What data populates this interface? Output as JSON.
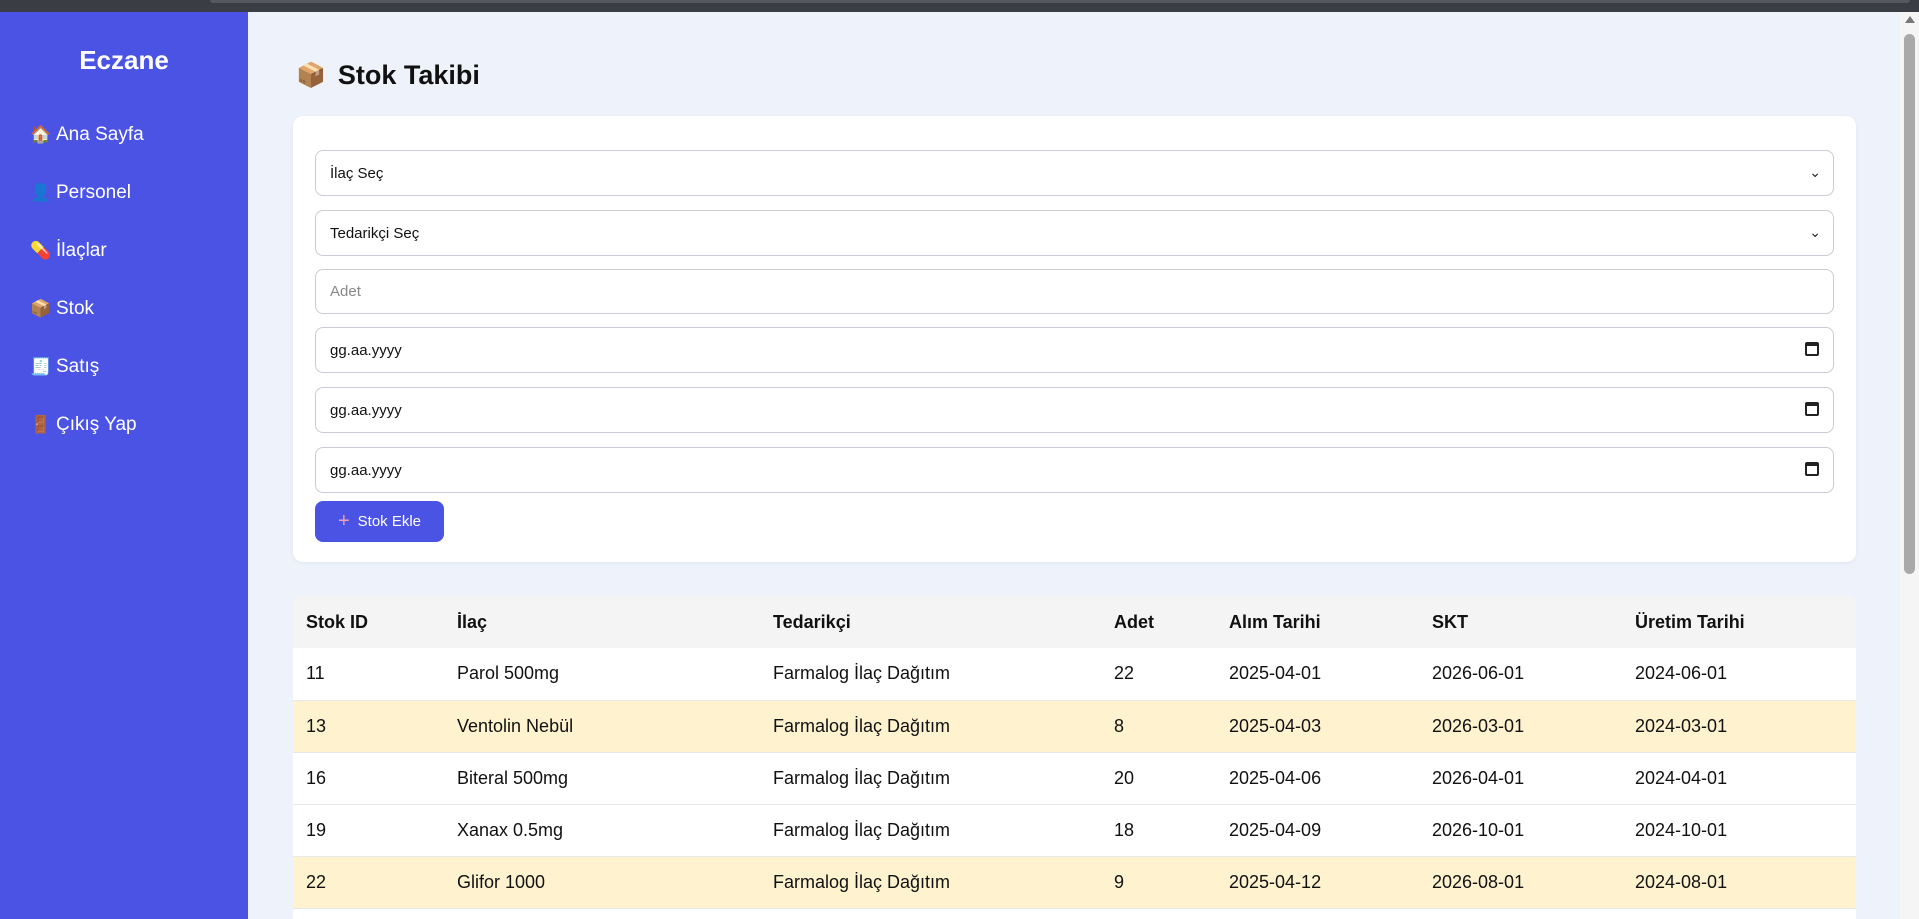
{
  "app": {
    "brand": "Eczane"
  },
  "sidebar": {
    "items": [
      {
        "icon": "🏠",
        "label": "Ana Sayfa"
      },
      {
        "icon": "👤",
        "label": "Personel"
      },
      {
        "icon": "💊",
        "label": "İlaçlar"
      },
      {
        "icon": "📦",
        "label": "Stok"
      },
      {
        "icon": "🧾",
        "label": "Satış"
      },
      {
        "icon": "🚪",
        "label": "Çıkış Yap"
      }
    ]
  },
  "page": {
    "icon": "📦",
    "title": "Stok Takibi"
  },
  "form": {
    "drug_select": "İlaç Seç",
    "supplier_select": "Tedarikçi Seç",
    "quantity_placeholder": "Adet",
    "date1": "gg.aa.yyyy",
    "date2": "gg.aa.yyyy",
    "date3": "gg.aa.yyyy",
    "add_button": "Stok Ekle",
    "add_button_icon": "+"
  },
  "table": {
    "headers": [
      "Stok ID",
      "İlaç",
      "Tedarikçi",
      "Adet",
      "Alım Tarihi",
      "SKT",
      "Üretim Tarihi"
    ],
    "rows": [
      [
        "11",
        "Parol 500mg",
        "Farmalog İlaç Dağıtım",
        "22",
        "2025-04-01",
        "2026-06-01",
        "2024-06-01"
      ],
      [
        "13",
        "Ventolin Nebül",
        "Farmalog İlaç Dağıtım",
        "8",
        "2025-04-03",
        "2026-03-01",
        "2024-03-01"
      ],
      [
        "16",
        "Biteral 500mg",
        "Farmalog İlaç Dağıtım",
        "20",
        "2025-04-06",
        "2026-04-01",
        "2024-04-01"
      ],
      [
        "19",
        "Xanax 0.5mg",
        "Farmalog İlaç Dağıtım",
        "18",
        "2025-04-09",
        "2026-10-01",
        "2024-10-01"
      ],
      [
        "22",
        "Glifor 1000",
        "Farmalog İlaç Dağıtım",
        "9",
        "2025-04-12",
        "2026-08-01",
        "2024-08-01"
      ]
    ]
  },
  "colors": {
    "sidebar": "#4a53e3",
    "button": "#4a53e3",
    "low_stock_row": "#fff3cf",
    "background": "#eef2fa"
  }
}
